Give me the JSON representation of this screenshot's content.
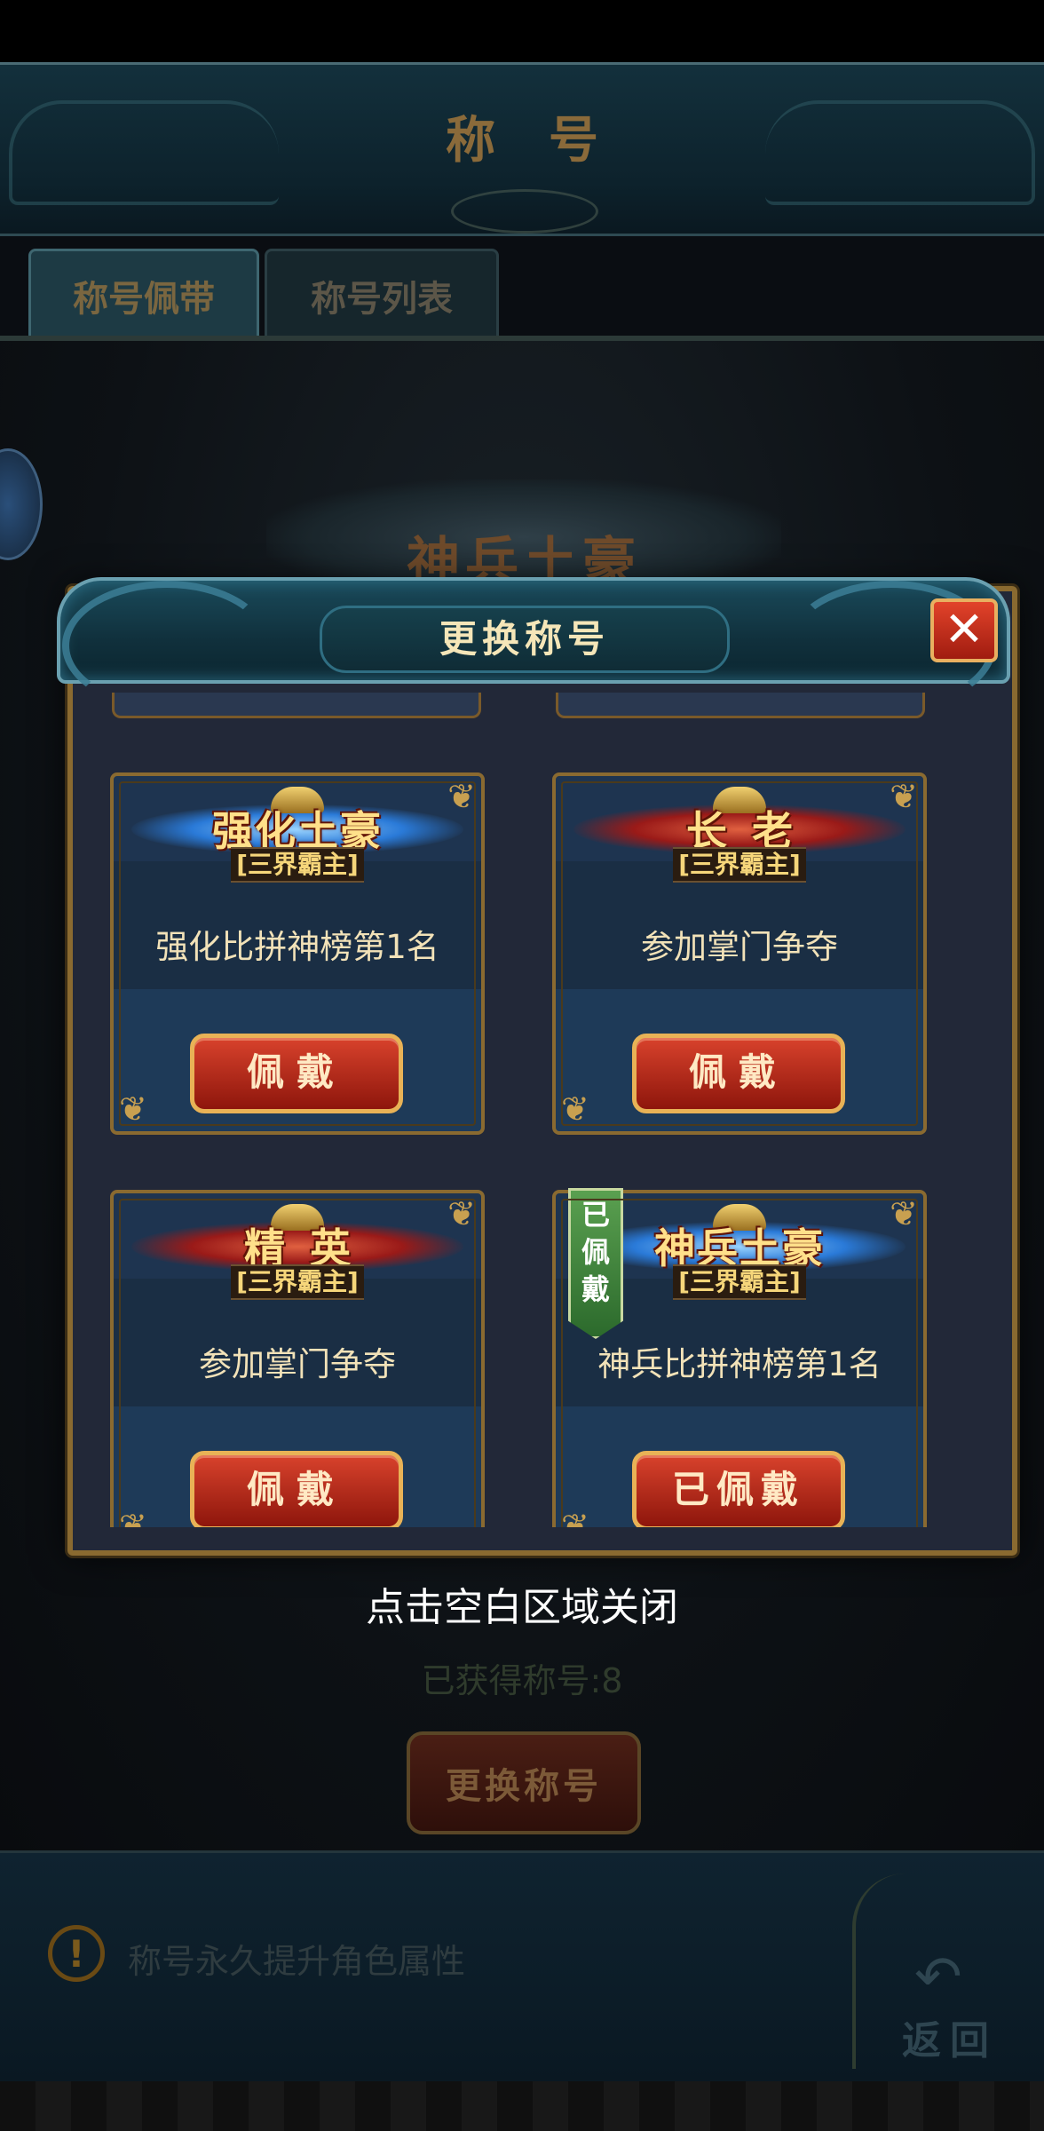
{
  "header": {
    "title": "称号"
  },
  "tabs": [
    {
      "label": "称号佩带"
    },
    {
      "label": "称号列表"
    }
  ],
  "background": {
    "current_title": "神兵土豪",
    "title_count": "已获得称号:8",
    "change_button": "更换称号",
    "info_text": "称号永久提升角色属性",
    "back_label": "返回"
  },
  "modal": {
    "title": "更换称号",
    "close_icon": "close-icon",
    "cards": [
      {
        "badge": "强化土豪",
        "badge_style": "blue-wings",
        "rank": "[三界霸主]",
        "desc": "强化比拼神榜第1名",
        "button": "佩戴",
        "equipped": false
      },
      {
        "badge": "长老",
        "badge_style": "red-wings",
        "rank": "[三界霸主]",
        "desc": "参加掌门争夺",
        "button": "佩戴",
        "equipped": false
      },
      {
        "badge": "精英",
        "badge_style": "red-wings",
        "rank": "[三界霸主]",
        "desc": "参加掌门争夺",
        "button": "佩戴",
        "equipped": false
      },
      {
        "badge": "神兵土豪",
        "badge_style": "blue-wings",
        "rank": "[三界霸主]",
        "desc": "神兵比拼神榜第1名",
        "button": "已佩戴",
        "equipped": true,
        "ribbon": "已佩戴"
      }
    ],
    "hint": "点击空白区域关闭"
  },
  "colors": {
    "accent_gold": "#e8b256",
    "button_red": "#c8321e",
    "equipped_green": "#4a8a44",
    "modal_bg": "#222838"
  }
}
